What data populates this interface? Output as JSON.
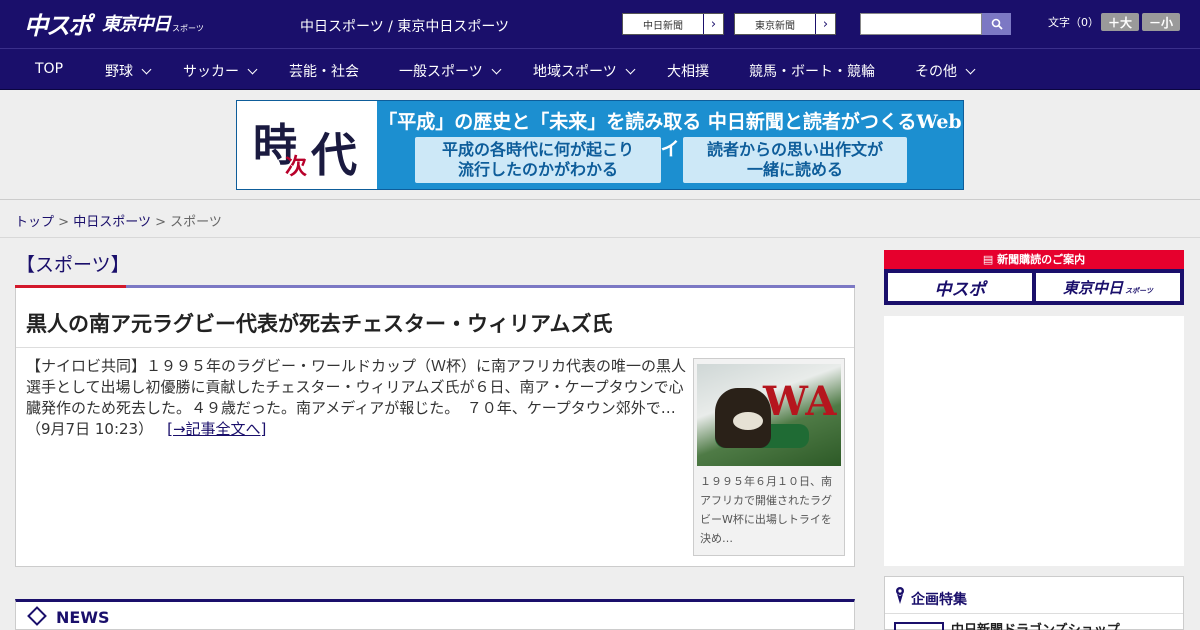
{
  "header": {
    "logo_main": "中スポ",
    "logo_sub": "東京中日",
    "logo_small": "スポーツ",
    "site_links": "中日スポーツ / 東京中日スポーツ",
    "paper_links": [
      "中日新聞",
      "東京新聞"
    ],
    "search_placeholder": "",
    "font_size_label": "文字（0）",
    "font_larger": "＋大",
    "font_smaller": "－小"
  },
  "nav": [
    {
      "label": "TOP",
      "dropdown": false
    },
    {
      "label": "野球",
      "dropdown": true
    },
    {
      "label": "サッカー",
      "dropdown": true
    },
    {
      "label": "芸能・社会",
      "dropdown": false
    },
    {
      "label": "一般スポーツ",
      "dropdown": true
    },
    {
      "label": "地域スポーツ",
      "dropdown": true
    },
    {
      "label": "大相撲",
      "dropdown": false
    },
    {
      "label": "競馬・ボート・競輪",
      "dropdown": false
    },
    {
      "label": "その他",
      "dropdown": true
    }
  ],
  "banner": {
    "logo_chars": [
      "時",
      "次",
      "代"
    ],
    "headline": "「平成」の歴史と「未来」を読み取る 中日新聞と読者がつくるWebサイト",
    "box1": [
      "平成の各時代に何が起こり",
      "流行したのかがわかる"
    ],
    "box2": [
      "読者からの思い出作文が",
      "一緒に読める"
    ]
  },
  "breadcrumb": {
    "home": "トップ",
    "parent": "中日スポーツ",
    "current": "スポーツ",
    "separator": ">"
  },
  "section": {
    "title": "【スポーツ】"
  },
  "article": {
    "title": "黒人の南ア元ラグビー代表が死去チェスター・ウィリアムズ氏",
    "body": "【ナイロビ共同】１９９５年のラグビー・ワールドカップ（Ｗ杯）に南アフリカ代表の唯一の黒人選手として出場し初優勝に貢献したチェスター・ウィリアムズ氏が６日、南ア・ケープタウンで心臓発作のため死去した。４９歳だった。南アメディアが報じた。　７０年、ケープタウン郊外で…",
    "date": "（9月7日 10:23）",
    "more_link": "[→記事全文へ]",
    "photo_caption": "１９９５年６月１０日、南アフリカで開催されたラグビーW杯に出場しトライを決め…",
    "photo_text": "WA"
  },
  "news": {
    "label": "NEWS"
  },
  "sidebar": {
    "subscribe_label": "新聞購読のご案内",
    "subscribe_buttons": [
      "中スポ",
      "東京中日"
    ],
    "subscribe_small": "スポーツ",
    "feature_title": "企画特集",
    "feature_item": "中日新聞ドラゴンズショップ"
  },
  "colors": {
    "brand_navy": "#1a0f6b",
    "accent_red": "#d3192b",
    "accent_purple": "#7c78c4"
  }
}
